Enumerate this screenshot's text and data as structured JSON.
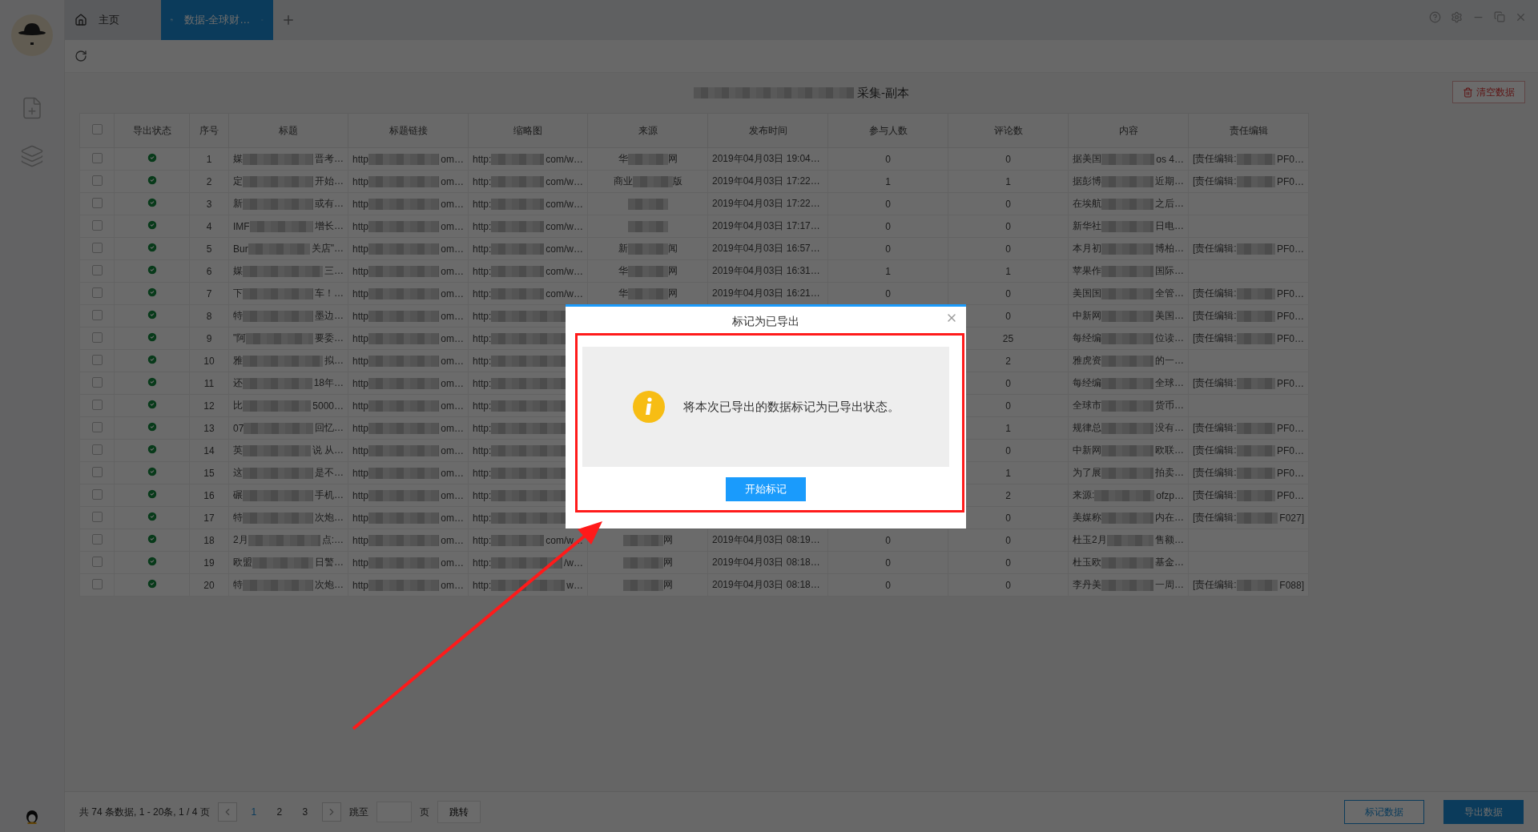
{
  "tabs": [
    {
      "kind": "home",
      "label": "主页",
      "selected": false
    },
    {
      "kind": "page",
      "label": "数据-全球财…",
      "selected": true
    }
  ],
  "page_title": {
    "kind": "masked",
    "tail": "采集-副本"
  },
  "clear_button": "清空数据",
  "table": {
    "header_checked": false,
    "columns": [
      "导出状态",
      "序号",
      "标题",
      "标题链接",
      "缩略图",
      "来源",
      "发布时间",
      "参与人数",
      "评论数",
      "内容",
      "责任编辑"
    ],
    "rows": [
      {
        "checked": false,
        "exported": true,
        "seq": "1",
        "title": {
          "kind": "masked",
          "head": "媒",
          "tail": "晋考…"
        },
        "link": {
          "kind": "masked",
          "head": "http",
          "tail": "om…"
        },
        "thumb": {
          "kind": "masked",
          "head": "http:",
          "tail": "com/w…"
        },
        "source": {
          "kind": "masked",
          "head": "华",
          "tail": "网"
        },
        "time": "2019年04月03日 19:04…",
        "participants": "0",
        "comments": "0",
        "content": {
          "kind": "masked",
          "head": "据美国",
          "tail": "os 4…"
        },
        "editor": {
          "kind": "masked",
          "head": "[责任编辑:",
          "tail": "PF0…"
        }
      },
      {
        "checked": false,
        "exported": true,
        "seq": "2",
        "title": {
          "kind": "masked",
          "head": "定",
          "tail": "开始…"
        },
        "link": {
          "kind": "masked",
          "head": "http",
          "tail": "om…"
        },
        "thumb": {
          "kind": "masked",
          "head": "http:",
          "tail": "com/w…"
        },
        "source": {
          "kind": "masked",
          "head": "商业",
          "tail": "版"
        },
        "time": "2019年04月03日 17:22…",
        "participants": "1",
        "comments": "1",
        "content": {
          "kind": "masked",
          "head": "据彭博",
          "tail": "近期…"
        },
        "editor": {
          "kind": "masked",
          "head": "[责任编辑:",
          "tail": "PF0…"
        }
      },
      {
        "checked": false,
        "exported": true,
        "seq": "3",
        "title": {
          "kind": "masked",
          "head": "新",
          "tail": "或有…"
        },
        "link": {
          "kind": "masked",
          "head": "http",
          "tail": "om…"
        },
        "thumb": {
          "kind": "masked",
          "head": "http:",
          "tail": "com/w…"
        },
        "source": {
          "kind": "blurred"
        },
        "time": "2019年04月03日 17:22…",
        "participants": "0",
        "comments": "0",
        "content": {
          "kind": "masked",
          "head": "在埃航",
          "tail": "之后…"
        }
      },
      {
        "checked": false,
        "exported": true,
        "seq": "4",
        "title": {
          "kind": "masked",
          "head": "IMF",
          "tail": "增长…"
        },
        "link": {
          "kind": "masked",
          "head": "http",
          "tail": "om…"
        },
        "thumb": {
          "kind": "masked",
          "head": "http:",
          "tail": "com/w…"
        },
        "source": {
          "kind": "blurred"
        },
        "time": "2019年04月03日 17:17…",
        "participants": "0",
        "comments": "0",
        "content": {
          "kind": "masked",
          "head": "新华社",
          "tail": "日电…"
        }
      },
      {
        "checked": false,
        "exported": true,
        "seq": "5",
        "title": {
          "kind": "masked",
          "head": "Bur",
          "tail": "关店\"…"
        },
        "link": {
          "kind": "masked",
          "head": "http",
          "tail": "om…"
        },
        "thumb": {
          "kind": "masked",
          "head": "http:",
          "tail": "com/w…"
        },
        "source": {
          "kind": "masked",
          "head": "新",
          "tail": "闻"
        },
        "time": "2019年04月03日 16:57…",
        "participants": "0",
        "comments": "0",
        "content": {
          "kind": "masked",
          "head": "本月初",
          "tail": "博柏…"
        },
        "editor": {
          "kind": "masked",
          "head": "[责任编辑:",
          "tail": "PF0…"
        }
      },
      {
        "checked": false,
        "exported": true,
        "seq": "6",
        "title": {
          "kind": "masked",
          "head": "媒",
          "tail": "三…"
        },
        "link": {
          "kind": "masked",
          "head": "http",
          "tail": "om…"
        },
        "thumb": {
          "kind": "masked",
          "head": "http:",
          "tail": "com/w…"
        },
        "source": {
          "kind": "masked",
          "head": "华",
          "tail": "网"
        },
        "time": "2019年04月03日 16:31…",
        "participants": "1",
        "comments": "1",
        "content": {
          "kind": "masked",
          "head": "苹果作",
          "tail": "国际…"
        }
      },
      {
        "checked": false,
        "exported": true,
        "seq": "7",
        "title": {
          "kind": "masked",
          "head": "下",
          "tail": "车！…"
        },
        "link": {
          "kind": "masked",
          "head": "http",
          "tail": "om…"
        },
        "thumb": {
          "kind": "masked",
          "head": "http:",
          "tail": "com/w…"
        },
        "source": {
          "kind": "masked",
          "head": "华",
          "tail": "网"
        },
        "time": "2019年04月03日 16:21…",
        "participants": "0",
        "comments": "0",
        "content": {
          "kind": "masked",
          "head": "美国国",
          "tail": "全管…"
        },
        "editor": {
          "kind": "masked",
          "head": "[责任编辑:",
          "tail": "PF0…"
        }
      },
      {
        "checked": false,
        "exported": true,
        "seq": "8",
        "title": {
          "kind": "masked",
          "head": "特",
          "tail": "墨边…"
        },
        "link": {
          "kind": "masked",
          "head": "http",
          "tail": "om…"
        },
        "thumb": {
          "kind": "masked",
          "head": "http:"
        },
        "comments": "0",
        "content": {
          "kind": "masked",
          "head": "中新网",
          "tail": "美国…"
        },
        "editor": {
          "kind": "masked",
          "head": "[责任编辑:",
          "tail": "PF0…"
        }
      },
      {
        "checked": false,
        "exported": true,
        "seq": "9",
        "title": {
          "kind": "masked",
          "head": "\"阿",
          "tail": "要委…"
        },
        "link": {
          "kind": "masked",
          "head": "http",
          "tail": "om…"
        },
        "thumb": {
          "kind": "masked",
          "head": "http:"
        },
        "comments": "25",
        "content": {
          "kind": "masked",
          "head": "每经编",
          "tail": "位读…"
        },
        "editor": {
          "kind": "masked",
          "head": "[责任编辑:",
          "tail": "PF0…"
        }
      },
      {
        "checked": false,
        "exported": true,
        "seq": "10",
        "title": {
          "kind": "masked",
          "head": "雅",
          "tail": "拟…"
        },
        "link": {
          "kind": "masked",
          "head": "http",
          "tail": "om…"
        },
        "thumb": {
          "kind": "masked",
          "head": "http:"
        },
        "comments": "2",
        "content": {
          "kind": "masked",
          "head": "雅虎资",
          "tail": "的一…"
        }
      },
      {
        "checked": false,
        "exported": true,
        "seq": "11",
        "title": {
          "kind": "masked",
          "head": "还",
          "tail": "18年…"
        },
        "link": {
          "kind": "masked",
          "head": "http",
          "tail": "om…"
        },
        "thumb": {
          "kind": "masked",
          "head": "http:"
        },
        "comments": "0",
        "content": {
          "kind": "masked",
          "head": "每经编",
          "tail": "全球…"
        },
        "editor": {
          "kind": "masked",
          "head": "[责任编辑:",
          "tail": "PF0…"
        }
      },
      {
        "checked": false,
        "exported": true,
        "seq": "12",
        "title": {
          "kind": "masked",
          "head": "比",
          "tail": "5000…"
        },
        "link": {
          "kind": "masked",
          "head": "http",
          "tail": "om…"
        },
        "thumb": {
          "kind": "masked",
          "head": "http:"
        },
        "comments": "0",
        "content": {
          "kind": "masked",
          "head": "全球市",
          "tail": "货币…"
        }
      },
      {
        "checked": false,
        "exported": true,
        "seq": "13",
        "title": {
          "kind": "masked",
          "head": "07",
          "tail": "回忆…"
        },
        "link": {
          "kind": "masked",
          "head": "http",
          "tail": "om…"
        },
        "thumb": {
          "kind": "masked",
          "head": "http:"
        },
        "comments": "1",
        "content": {
          "kind": "masked",
          "head": "规律总",
          "tail": "没有…"
        },
        "editor": {
          "kind": "masked",
          "head": "[责任编辑:",
          "tail": "PF0…"
        }
      },
      {
        "checked": false,
        "exported": true,
        "seq": "14",
        "title": {
          "kind": "masked",
          "head": "英",
          "tail": "说 从…"
        },
        "link": {
          "kind": "masked",
          "head": "http",
          "tail": "om…"
        },
        "thumb": {
          "kind": "masked",
          "head": "http:"
        },
        "comments": "0",
        "content": {
          "kind": "masked",
          "head": "中新网",
          "tail": "欧联…"
        },
        "editor": {
          "kind": "masked",
          "head": "[责任编辑:",
          "tail": "PF0…"
        }
      },
      {
        "checked": false,
        "exported": true,
        "seq": "15",
        "title": {
          "kind": "masked",
          "head": "这",
          "tail": "是不…"
        },
        "link": {
          "kind": "masked",
          "head": "http",
          "tail": "om…"
        },
        "thumb": {
          "kind": "masked",
          "head": "http:"
        },
        "comments": "1",
        "content": {
          "kind": "masked",
          "head": "为了展",
          "tail": "拍卖…"
        },
        "editor": {
          "kind": "masked",
          "head": "[责任编辑:",
          "tail": "PF0…"
        }
      },
      {
        "checked": false,
        "exported": true,
        "seq": "16",
        "title": {
          "kind": "masked",
          "head": "碾",
          "tail": "手机…"
        },
        "link": {
          "kind": "masked",
          "head": "http",
          "tail": "om…"
        },
        "thumb": {
          "kind": "masked",
          "head": "http:"
        },
        "comments": "2",
        "content": {
          "kind": "masked",
          "head": "来源:",
          "tail": "ofzp…"
        },
        "editor": {
          "kind": "masked",
          "head": "[责任编辑:",
          "tail": "PF0…"
        }
      },
      {
        "checked": false,
        "exported": true,
        "seq": "17",
        "title": {
          "kind": "masked",
          "head": "特",
          "tail": "次炮…"
        },
        "link": {
          "kind": "masked",
          "head": "http",
          "tail": "om…"
        },
        "thumb": {
          "kind": "masked",
          "head": "http:"
        },
        "comments": "0",
        "content": {
          "kind": "masked",
          "head": "美媒称",
          "tail": "内在…"
        },
        "editor": {
          "kind": "masked",
          "head": "[责任编辑:",
          "tail": "F027]"
        }
      },
      {
        "checked": false,
        "exported": true,
        "seq": "18",
        "title": {
          "kind": "masked",
          "head": "2月",
          "tail": "点:…"
        },
        "link": {
          "kind": "masked",
          "head": "http",
          "tail": "om…"
        },
        "thumb": {
          "kind": "masked",
          "head": "http:",
          "tail": "com/w…"
        },
        "source": {
          "kind": "masked",
          "tail": "网"
        },
        "time": "2019年04月03日 08:19…",
        "participants": "0",
        "comments": "0",
        "content": {
          "kind": "masked",
          "head": "杜玉2月",
          "tail": "售额…"
        }
      },
      {
        "checked": false,
        "exported": true,
        "seq": "19",
        "title": {
          "kind": "masked",
          "head": "欧盟",
          "tail": "日警…"
        },
        "link": {
          "kind": "masked",
          "head": "http",
          "tail": "om…"
        },
        "thumb": {
          "kind": "masked",
          "head": "http:",
          "tail": "/w…"
        },
        "source": {
          "kind": "masked",
          "tail": "网"
        },
        "time": "2019年04月03日 08:18…",
        "participants": "0",
        "comments": "0",
        "content": {
          "kind": "masked",
          "head": "杜玉欧",
          "tail": "基金…"
        }
      },
      {
        "checked": false,
        "exported": true,
        "seq": "20",
        "title": {
          "kind": "masked",
          "head": "特",
          "tail": "次炮…"
        },
        "link": {
          "kind": "masked",
          "head": "http",
          "tail": "om…"
        },
        "thumb": {
          "kind": "masked",
          "head": "http:",
          "tail": "w…"
        },
        "source": {
          "kind": "masked",
          "tail": "网"
        },
        "time": "2019年04月03日 08:18…",
        "participants": "0",
        "comments": "0",
        "content": {
          "kind": "masked",
          "head": "李丹美",
          "tail": "一周…"
        },
        "editor": {
          "kind": "masked",
          "head": "[责任编辑:",
          "tail": "F088]"
        }
      }
    ]
  },
  "pagination": {
    "summary": "共 74 条数据, 1 - 20条, 1 / 4 页",
    "pages": [
      {
        "label": "1",
        "selected": true
      },
      {
        "label": "2",
        "selected": false
      },
      {
        "label": "3",
        "selected": false
      }
    ],
    "jump_label": "跳至",
    "page_unit": "页",
    "jump_button": "跳转"
  },
  "actions": [
    "标记数据",
    "导出数据"
  ],
  "dialog": {
    "title": "标记为已导出",
    "message": "将本次已导出的数据标记为已导出状态。",
    "button": "开始标记"
  }
}
